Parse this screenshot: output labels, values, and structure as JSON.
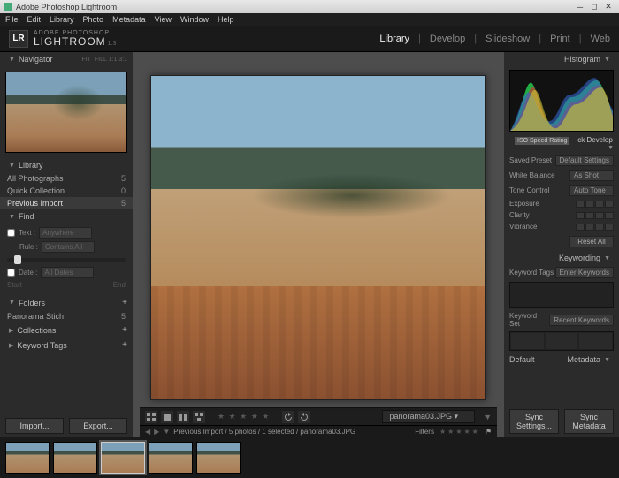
{
  "titlebar": {
    "title": "Adobe Photoshop Lightroom"
  },
  "menubar": [
    "File",
    "Edit",
    "Library",
    "Photo",
    "Metadata",
    "View",
    "Window",
    "Help"
  ],
  "logo": {
    "badge": "LR",
    "line1": "ADOBE PHOTOSHOP",
    "line2": "LIGHTROOM",
    "version": "1.3"
  },
  "modules": [
    {
      "label": "Library",
      "active": true
    },
    {
      "label": "Develop",
      "active": false
    },
    {
      "label": "Slideshow",
      "active": false
    },
    {
      "label": "Print",
      "active": false
    },
    {
      "label": "Web",
      "active": false
    }
  ],
  "navigator": {
    "title": "Navigator",
    "mode": "FIT",
    "sub": "FILL   1:1   3:1"
  },
  "library_panel": {
    "title": "Library",
    "items": [
      {
        "label": "All Photographs",
        "count": "5"
      },
      {
        "label": "Quick Collection",
        "count": "0"
      },
      {
        "label": "Previous Import",
        "count": "5",
        "selected": true
      }
    ]
  },
  "find": {
    "title": "Find",
    "text_label": "Text :",
    "text_mode": "Anywhere",
    "rule_label": "Rule :",
    "rule_mode": "Contains All",
    "date_label": "Date :",
    "date_mode": "All Dates",
    "start": "Start",
    "end": "End"
  },
  "folders": {
    "title": "Folders",
    "items": [
      {
        "label": "Panorama Stich",
        "count": "5"
      }
    ]
  },
  "collections": {
    "title": "Collections"
  },
  "keyword_tags": {
    "title": "Keyword Tags"
  },
  "left_buttons": {
    "import": "Import...",
    "export": "Export..."
  },
  "toolbar": {
    "stars": "★ ★ ★ ★ ★",
    "path_label": "panorama03.JPG"
  },
  "info_bar": {
    "crumb": "Previous Import / 5 photos / 1 selected / panorama03.JPG",
    "filters": "Filters"
  },
  "histogram": {
    "title": "Histogram",
    "iso_label": "ISO Speed Rating"
  },
  "quick_develop": {
    "title": "ck Develop",
    "saved_preset": {
      "label": "Saved Preset",
      "value": "Default Settings"
    },
    "white_balance": {
      "label": "White Balance",
      "value": "As Shot"
    },
    "tone_control": {
      "label": "Tone Control",
      "value": "Auto Tone"
    },
    "exposure": "Exposure",
    "clarity": "Clarity",
    "vibrance": "Vibrance",
    "reset": "Reset All"
  },
  "keywording": {
    "title": "Keywording",
    "tags_label": "Keyword Tags",
    "tags_value": "Enter Keywords",
    "set_label": "Keyword Set",
    "set_value": "Recent Keywords"
  },
  "metadata": {
    "title": "Metadata",
    "mode": "Default"
  },
  "right_buttons": {
    "sync_settings": "Sync Settings...",
    "sync_metadata": "Sync Metadata"
  },
  "filmstrip": {
    "count": 5,
    "selected_index": 2
  }
}
